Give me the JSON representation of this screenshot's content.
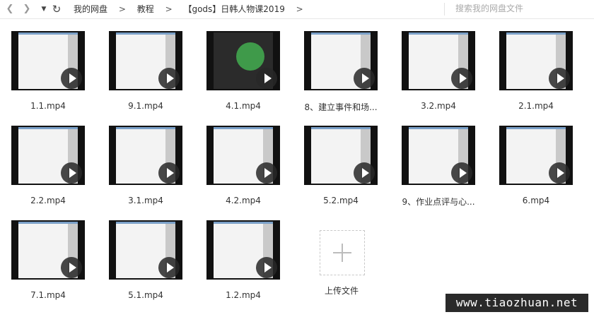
{
  "toolbar": {
    "back_icon": "chevron-left-icon",
    "forward_icon": "chevron-right-icon",
    "dropdown_icon": "caret-down-icon",
    "refresh_icon": "refresh-icon",
    "breadcrumbs": [
      "我的网盘",
      "教程",
      "【gods】日韩人物课2019"
    ],
    "breadcrumb_sep": ">",
    "search_placeholder": "搜索我的网盘文件"
  },
  "files": [
    {
      "name": "1.1.mp4"
    },
    {
      "name": "9.1.mp4"
    },
    {
      "name": "4.1.mp4"
    },
    {
      "name": "8、建立事件和场..."
    },
    {
      "name": "3.2.mp4"
    },
    {
      "name": "2.1.mp4"
    },
    {
      "name": "2.2.mp4"
    },
    {
      "name": "3.1.mp4"
    },
    {
      "name": "4.2.mp4"
    },
    {
      "name": "5.2.mp4"
    },
    {
      "name": "9、作业点评与心..."
    },
    {
      "name": "6.mp4"
    },
    {
      "name": "7.1.mp4"
    },
    {
      "name": "5.1.mp4"
    },
    {
      "name": "1.2.mp4"
    }
  ],
  "upload": {
    "label": "上传文件",
    "icon": "plus-icon"
  },
  "watermark": "www.tiaozhuan.net"
}
